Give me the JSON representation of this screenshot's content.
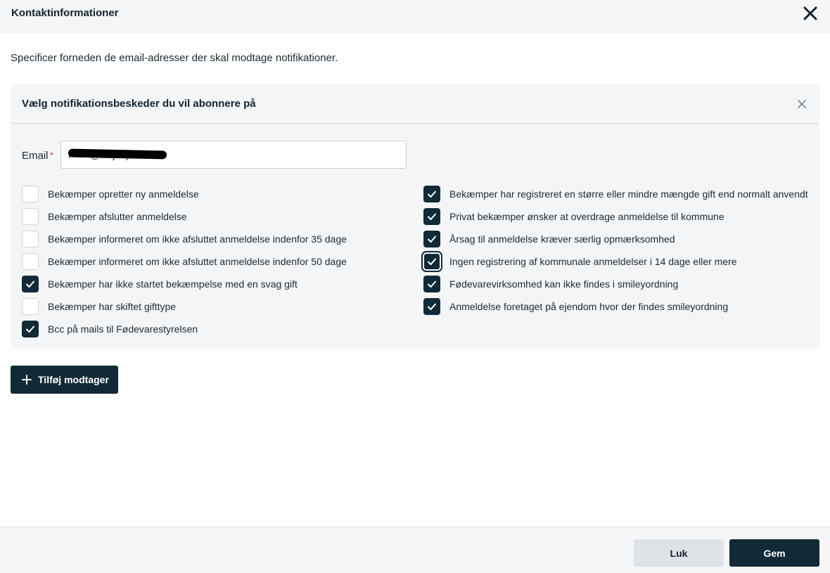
{
  "header": {
    "title": "Kontaktinformationer",
    "close_icon": "close-icon"
  },
  "intro": "Specificer forneden de email-adresser der skal modtage notifikationer.",
  "panel": {
    "title": "Vælg notifikationsbeskeder du vil abonnere på",
    "email_label": "Email",
    "required_mark": "*",
    "email_value": "f       @miljoeportal.dk"
  },
  "left_options": [
    {
      "label": "Bekæmper opretter ny anmeldelse",
      "checked": false
    },
    {
      "label": "Bekæmper afslutter anmeldelse",
      "checked": false
    },
    {
      "label": "Bekæmper informeret om ikke afsluttet anmeldelse indenfor 35 dage",
      "checked": false
    },
    {
      "label": "Bekæmper informeret om ikke afsluttet anmeldelse indenfor 50 dage",
      "checked": false
    },
    {
      "label": "Bekæmper har ikke startet bekæmpelse med en svag gift",
      "checked": true
    },
    {
      "label": "Bekæmper har skiftet gifttype",
      "checked": false
    },
    {
      "label": "Bcc på mails til Fødevarestyrelsen",
      "checked": true
    }
  ],
  "right_options": [
    {
      "label": "Bekæmper har registreret en større eller mindre mængde gift end normalt anvendt",
      "checked": true
    },
    {
      "label": "Privat bekæmper ønsker at overdrage anmeldelse til kommune",
      "checked": true
    },
    {
      "label": "Årsag til anmeldelse kræver særlig opmærksomhed",
      "checked": true
    },
    {
      "label": "Ingen registrering af kommunale anmeldelser i 14 dage eller mere",
      "checked": true,
      "focused": true
    },
    {
      "label": "Fødevarevirksomhed kan ikke findes i smileyordning",
      "checked": true
    },
    {
      "label": "Anmeldelse foretaget på ejendom hvor der findes smileyordning",
      "checked": true
    }
  ],
  "add_button": {
    "label": "Tilføj modtager"
  },
  "footer": {
    "close_label": "Luk",
    "save_label": "Gem"
  },
  "colors": {
    "primary": "#112a36",
    "header_bg": "#f4f6f8",
    "panel_bg": "#f3f5f7",
    "required": "#c1272d"
  }
}
